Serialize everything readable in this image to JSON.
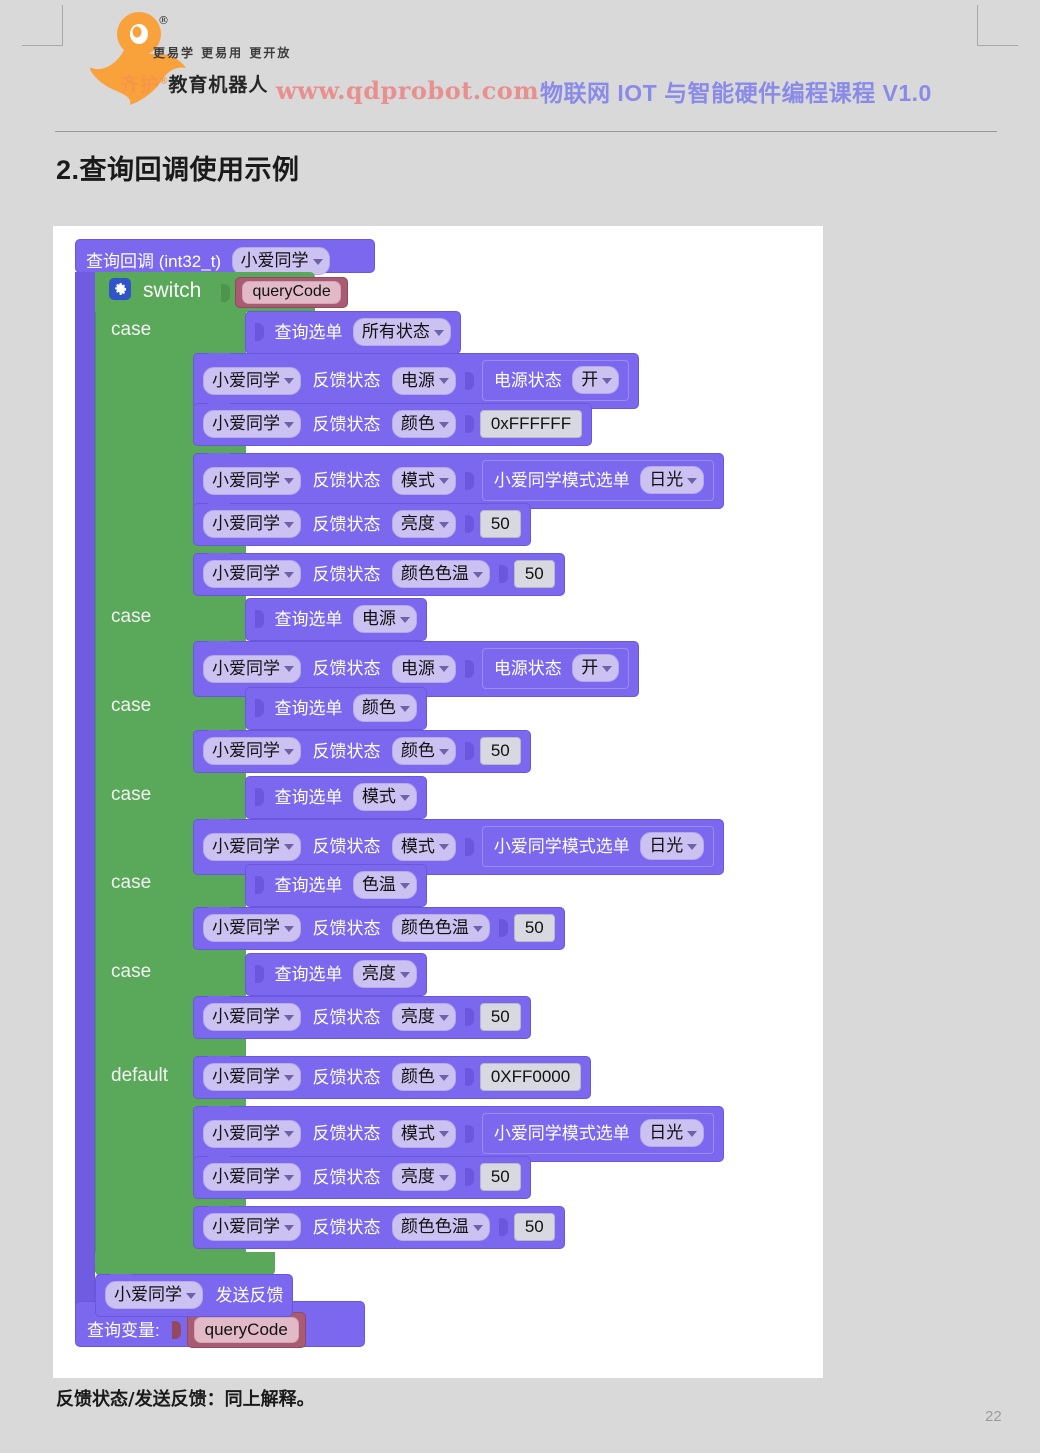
{
  "header": {
    "logo_slogan": "更易学 更易用 更开放",
    "logo_brand": "齐护",
    "logo_brand_sup": "®",
    "logo_brand_tail": "教育机器人",
    "site_url": "www.qdprobot.com",
    "course_title": "物联网 IOT 与智能硬件编程课程 V1.0",
    "url_color": "#e8908f",
    "title_color": "#8a8ae8",
    "brand_color": "#f79646"
  },
  "section": {
    "title": "2.查询回调使用示例"
  },
  "caption": "反馈状态/发送反馈：同上解释。",
  "page_number": "22",
  "palette": {
    "purple": "#7b68ee",
    "green": "#5aa85a",
    "rose": "#a85b72",
    "field": "#ccc2f2",
    "number": "#d8d8e0",
    "canvas": "#ffffff",
    "page": "#d9d9d9"
  },
  "blocks": {
    "hat": {
      "label": "查询回调 (int32_t)",
      "device": "小爱同学"
    },
    "switch": {
      "label": "switch",
      "gear_icon": "gear-icon",
      "value": "queryCode"
    },
    "case_keyword": "case",
    "default_keyword": "default",
    "query_menu_label": "查询选单",
    "feedback_label": "反馈状态",
    "device_label": "小爱同学",
    "power_state_label": "电源状态",
    "mode_menu_label": "小爱同学模式选单",
    "send_feedback_label": "发送反馈",
    "query_var_label": "查询变量:",
    "query_var_value": "queryCode",
    "cases": [
      {
        "selector": "所有状态",
        "statements": [
          {
            "device": "小爱同学",
            "action": "反馈状态",
            "prop": "电源",
            "value_kind": "inner-menu",
            "inner_label": "电源状态",
            "inner_value": "开"
          },
          {
            "device": "小爱同学",
            "action": "反馈状态",
            "prop": "颜色",
            "value_kind": "number",
            "value": "0xFFFFFF"
          },
          {
            "device": "小爱同学",
            "action": "反馈状态",
            "prop": "模式",
            "value_kind": "inner-menu",
            "inner_label": "小爱同学模式选单",
            "inner_value": "日光"
          },
          {
            "device": "小爱同学",
            "action": "反馈状态",
            "prop": "亮度",
            "value_kind": "number",
            "value": "50"
          },
          {
            "device": "小爱同学",
            "action": "反馈状态",
            "prop": "颜色色温",
            "value_kind": "number",
            "value": "50"
          }
        ]
      },
      {
        "selector": "电源",
        "statements": [
          {
            "device": "小爱同学",
            "action": "反馈状态",
            "prop": "电源",
            "value_kind": "inner-menu",
            "inner_label": "电源状态",
            "inner_value": "开"
          }
        ]
      },
      {
        "selector": "颜色",
        "statements": [
          {
            "device": "小爱同学",
            "action": "反馈状态",
            "prop": "颜色",
            "value_kind": "number",
            "value": "50"
          }
        ]
      },
      {
        "selector": "模式",
        "statements": [
          {
            "device": "小爱同学",
            "action": "反馈状态",
            "prop": "模式",
            "value_kind": "inner-menu",
            "inner_label": "小爱同学模式选单",
            "inner_value": "日光"
          }
        ]
      },
      {
        "selector": "色温",
        "statements": [
          {
            "device": "小爱同学",
            "action": "反馈状态",
            "prop": "颜色色温",
            "value_kind": "number",
            "value": "50"
          }
        ]
      },
      {
        "selector": "亮度",
        "statements": [
          {
            "device": "小爱同学",
            "action": "反馈状态",
            "prop": "亮度",
            "value_kind": "number",
            "value": "50"
          }
        ]
      }
    ],
    "default_case": {
      "statements": [
        {
          "device": "小爱同学",
          "action": "反馈状态",
          "prop": "颜色",
          "value_kind": "number",
          "value": "0XFF0000"
        },
        {
          "device": "小爱同学",
          "action": "反馈状态",
          "prop": "模式",
          "value_kind": "inner-menu",
          "inner_label": "小爱同学模式选单",
          "inner_value": "日光"
        },
        {
          "device": "小爱同学",
          "action": "反馈状态",
          "prop": "亮度",
          "value_kind": "number",
          "value": "50"
        },
        {
          "device": "小爱同学",
          "action": "反馈状态",
          "prop": "颜色色温",
          "value_kind": "number",
          "value": "50"
        }
      ]
    }
  }
}
